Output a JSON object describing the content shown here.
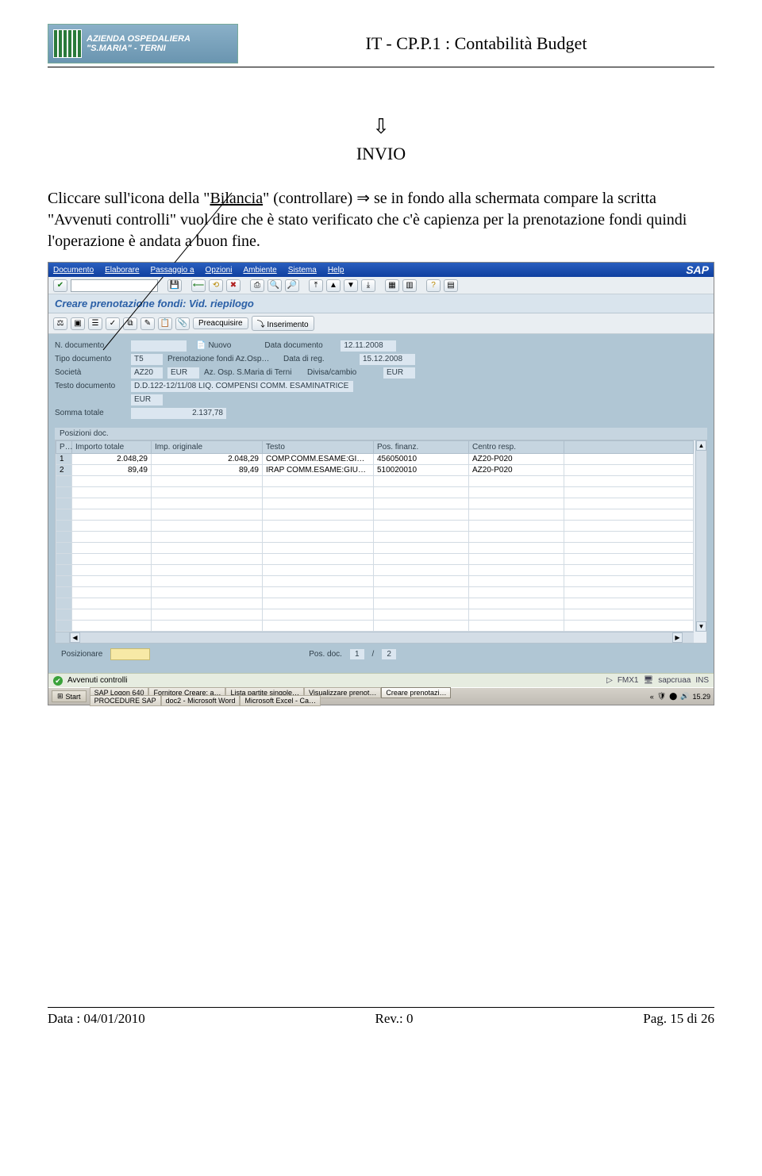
{
  "header": {
    "org_line1": "AZIENDA OSPEDALIERA",
    "org_line2": "\"S.MARIA\" - TERNI",
    "doc_title": "IT - CP.P.1 : Contabilità Budget"
  },
  "invio": {
    "label": "INVIO"
  },
  "paragraph": {
    "p1_a": "Cliccare sull'icona della \"",
    "p1_u": "Bilancia",
    "p1_b": "\" (controllare)  ⇒ se in fondo alla schermata compare la scritta \"Avvenuti controlli\" vuol dire che è stato verificato che c'è capienza per la prenotazione fondi quindi l'operazione è andata a buon fine."
  },
  "sap": {
    "menus": [
      "Documento",
      "Elaborare",
      "Passaggio a",
      "Opzioni",
      "Ambiente",
      "Sistema",
      "Help"
    ],
    "logo": "SAP",
    "screen_title": "Creare prenotazione fondi: Vid. riepilogo",
    "app_buttons": [
      "Preacquisire",
      "Inserimento"
    ],
    "form": {
      "n_doc_label": "N. documento",
      "n_doc_val": "",
      "nuovo": "Nuovo",
      "data_doc_label": "Data documento",
      "data_doc_val": "12.11.2008",
      "tipo_doc_label": "Tipo documento",
      "tipo_doc_val": "T5",
      "tipo_doc_txt": "Prenotazione fondi Az.Osp…",
      "data_reg_label": "Data di reg.",
      "data_reg_val": "15.12.2008",
      "societa_label": "Società",
      "societa_val": "AZ20",
      "societa_cur": "EUR",
      "societa_txt": "Az. Osp. S.Maria di Terni",
      "divisa_label": "Divisa/cambio",
      "divisa_val": "EUR",
      "testo_label": "Testo documento",
      "testo_val": "D.D.122-12/11/08 LIQ. COMPENSI COMM. ESAMINATRICE",
      "cur2": "EUR",
      "somma_label": "Somma totale",
      "somma_val": "2.137,78"
    },
    "grid": {
      "section_label": "Posizioni doc.",
      "headers": [
        "P…",
        "Importo totale",
        "Imp. originale",
        "Testo",
        "Pos. finanz.",
        "Centro resp."
      ],
      "rows": [
        {
          "n": "1",
          "imp": "2.048,29",
          "orig": "2.048,29",
          "testo": "COMP.COMM.ESAME:GI…",
          "pos": "456050010",
          "centro": "AZ20-P020"
        },
        {
          "n": "2",
          "imp": "89,49",
          "orig": "89,49",
          "testo": "IRAP COMM.ESAME:GIU…",
          "pos": "510020010",
          "centro": "AZ20-P020"
        }
      ]
    },
    "posizionare": {
      "label": "Posizionare",
      "pos_doc_label": "Pos. doc.",
      "pos_cur": "1",
      "pos_sep": "/",
      "pos_tot": "2"
    },
    "status": {
      "message": "Avvenuti controlli",
      "right1": "FMX1",
      "right2": "sapcruaa",
      "right3": "INS"
    },
    "taskbar": {
      "start": "Start",
      "items": [
        "SAP Logon 640",
        "Fornitore Creare: a…",
        "Lista partite singole…",
        "Visualizzare prenot…",
        "Creare prenotazi…",
        "PROCEDURE SAP",
        "doc2 - Microsoft Word",
        "Microsoft Excel - Ca…"
      ],
      "active_index": 4,
      "clock": "15.29"
    }
  },
  "footer": {
    "left": "Data : 04/01/2010",
    "center": "Rev.: 0",
    "right": "Pag. 15 di 26"
  }
}
